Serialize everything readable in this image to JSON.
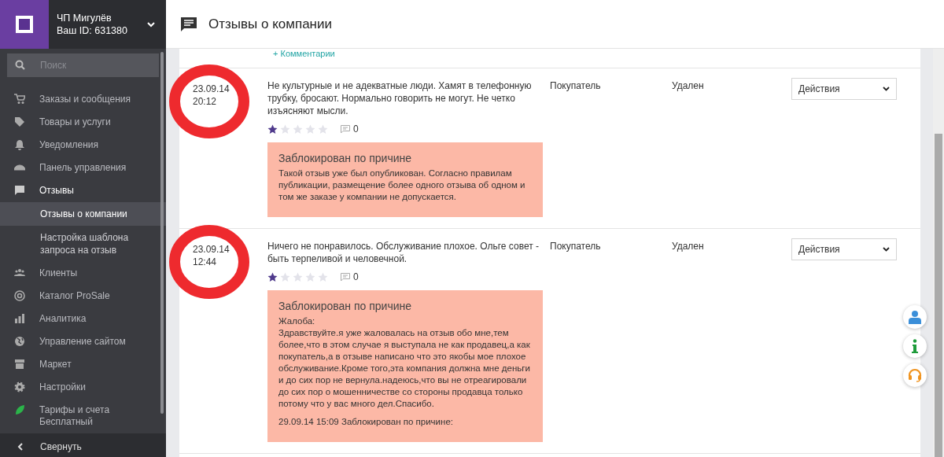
{
  "account": {
    "name": "ЧП Мигулёв",
    "id_label": "Ваш ID: 631380"
  },
  "search": {
    "placeholder": "Поиск"
  },
  "sidebar": {
    "items": [
      {
        "label": "Заказы и сообщения",
        "expanded": false
      },
      {
        "label": "Товары и услуги",
        "expanded": false
      },
      {
        "label": "Уведомления",
        "expanded": false
      },
      {
        "label": "Панель управления",
        "expanded": false
      },
      {
        "label": "Отзывы",
        "expanded": true,
        "children": [
          {
            "label": "Отзывы о компании",
            "selected": true
          },
          {
            "label": "Настройка шаблона запроса на отзыв",
            "selected": false
          }
        ]
      },
      {
        "label": "Клиенты",
        "expanded": false
      },
      {
        "label": "Каталог ProSale",
        "expanded": false
      },
      {
        "label": "Аналитика",
        "expanded": false
      },
      {
        "label": "Управление сайтом",
        "expanded": false
      },
      {
        "label": "Маркет",
        "expanded": false
      },
      {
        "label": "Настройки",
        "expanded": false
      },
      {
        "label": "Тарифы и счета",
        "sublabel": "Бесплатный",
        "expanded": false
      }
    ]
  },
  "collapse_label": "Свернуть",
  "header": {
    "title": "Отзывы о компании"
  },
  "previous_row": {
    "comments_link": "+ Комментарии"
  },
  "reviews": [
    {
      "date": "23.09.14",
      "time": "20:12",
      "circled": true,
      "text": "Не культурные и не адекватные люди. Хамят в телефонную трубку, бросают. Нормально говорить не могут. Не четко изъясняют мысли.",
      "stars": 1,
      "comments": "0",
      "author_type": "Покупатель",
      "status": "Удален",
      "action": "Действия",
      "block_title": "Заблокирован по причине",
      "block_paragraphs": [
        "Такой отзыв уже был опубликован. Согласно правилам публикации, размещение более одного отзыва об одном и том же заказе у компании не допускается."
      ]
    },
    {
      "date": "23.09.14",
      "time": "12:44",
      "circled": true,
      "text": "Ничего не понравилось. Обслуживание плохое. Ольге совет - быть терпеливой и человечной.",
      "stars": 1,
      "comments": "0",
      "author_type": "Покупатель",
      "status": "Удален",
      "action": "Действия",
      "block_title": "Заблокирован по причине",
      "block_paragraphs": [
        "Жалоба:\nЗдравствуйте.я уже жаловалась на отзыв обо мне,тем более,что в этом случае я выступала не как продавец,а как покупатель,а в отзыве написано что это якобы мое плохое обслуживание.Кроме того,эта компания должна мне деньги и до сих пор не вернула.надеюсь,что вы не отреагировали до сих пор о мошенничестве со стороны продавца только потому что у вас много дел.Спасибо.",
        "29.09.14 15:09 Заблокирован по причине:"
      ]
    }
  ]
}
